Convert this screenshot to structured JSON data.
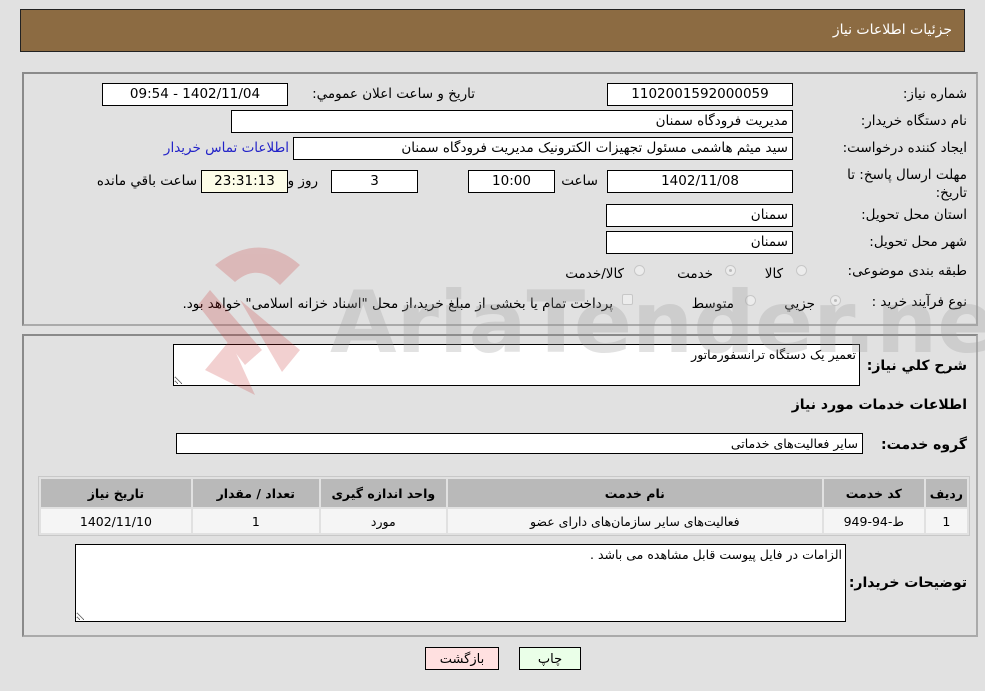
{
  "header": {
    "title": "جزئیات اطلاعات نیاز"
  },
  "fields": {
    "need_number": {
      "label": "شماره نیاز:",
      "value": "1102001592000059"
    },
    "announce_datetime": {
      "label": "تاریخ و ساعت اعلان عمومي:",
      "value": "1402/11/04 - 09:54"
    },
    "buyer_org": {
      "label": "نام دستگاه خریدار:",
      "value": "مدیریت فرودگاه سمنان"
    },
    "requester": {
      "label": "ایجاد کننده درخواست:",
      "value": "سید میثم هاشمی مسئول تجهیزات الکترونیک مدیریت فرودگاه سمنان"
    },
    "buyer_contact_link": "اطلاعات تماس خریدار",
    "deadline": {
      "label": "مهلت ارسال پاسخ: تا تاریخ:",
      "date": "1402/11/08",
      "time_label": "ساعت",
      "time": "10:00",
      "days": "3",
      "days_label": "روز و",
      "remaining": "23:31:13",
      "remaining_label": "ساعت باقي مانده"
    },
    "province": {
      "label": "استان محل تحویل:",
      "value": "سمنان"
    },
    "city": {
      "label": "شهر محل تحویل:",
      "value": "سمنان"
    },
    "category": {
      "label": "طبقه بندی موضوعی:",
      "options": [
        "کالا",
        "خدمت",
        "کالا/خدمت"
      ],
      "selected": "خدمت"
    },
    "purchase_type": {
      "label": "نوع فرآیند خرید :",
      "options": [
        "جزيي",
        "متوسط"
      ],
      "selected": "جزيي",
      "treasury_note": "پرداخت تمام یا بخشی از مبلغ خرید،از محل \"اسناد خزانه اسلامی\" خواهد بود."
    }
  },
  "description": {
    "label": "شرح کلي نیاز:",
    "value": "تعمیر یک دستگاه ترانسفورماتور"
  },
  "services_section": {
    "title": "اطلاعات خدمات مورد نیاز",
    "group_label": "گروه خدمت:",
    "group_value": "سایر فعالیت‌های خدماتی"
  },
  "table": {
    "headers": [
      "ردیف",
      "کد خدمت",
      "نام خدمت",
      "واحد اندازه گیری",
      "تعداد / مقدار",
      "تاریخ نیاز"
    ],
    "rows": [
      [
        "1",
        "ط-94-949",
        "فعالیت‌های سایر سازمان‌های دارای عضو",
        "مورد",
        "1",
        "1402/11/10"
      ]
    ]
  },
  "buyer_notes": {
    "label": "توضیحات خریدار:",
    "value": "الزامات در فایل پیوست قابل مشاهده می باشد ."
  },
  "buttons": {
    "print": "چاپ",
    "back": "بازگشت"
  },
  "watermark": {
    "text": "AriaTender.neT"
  }
}
